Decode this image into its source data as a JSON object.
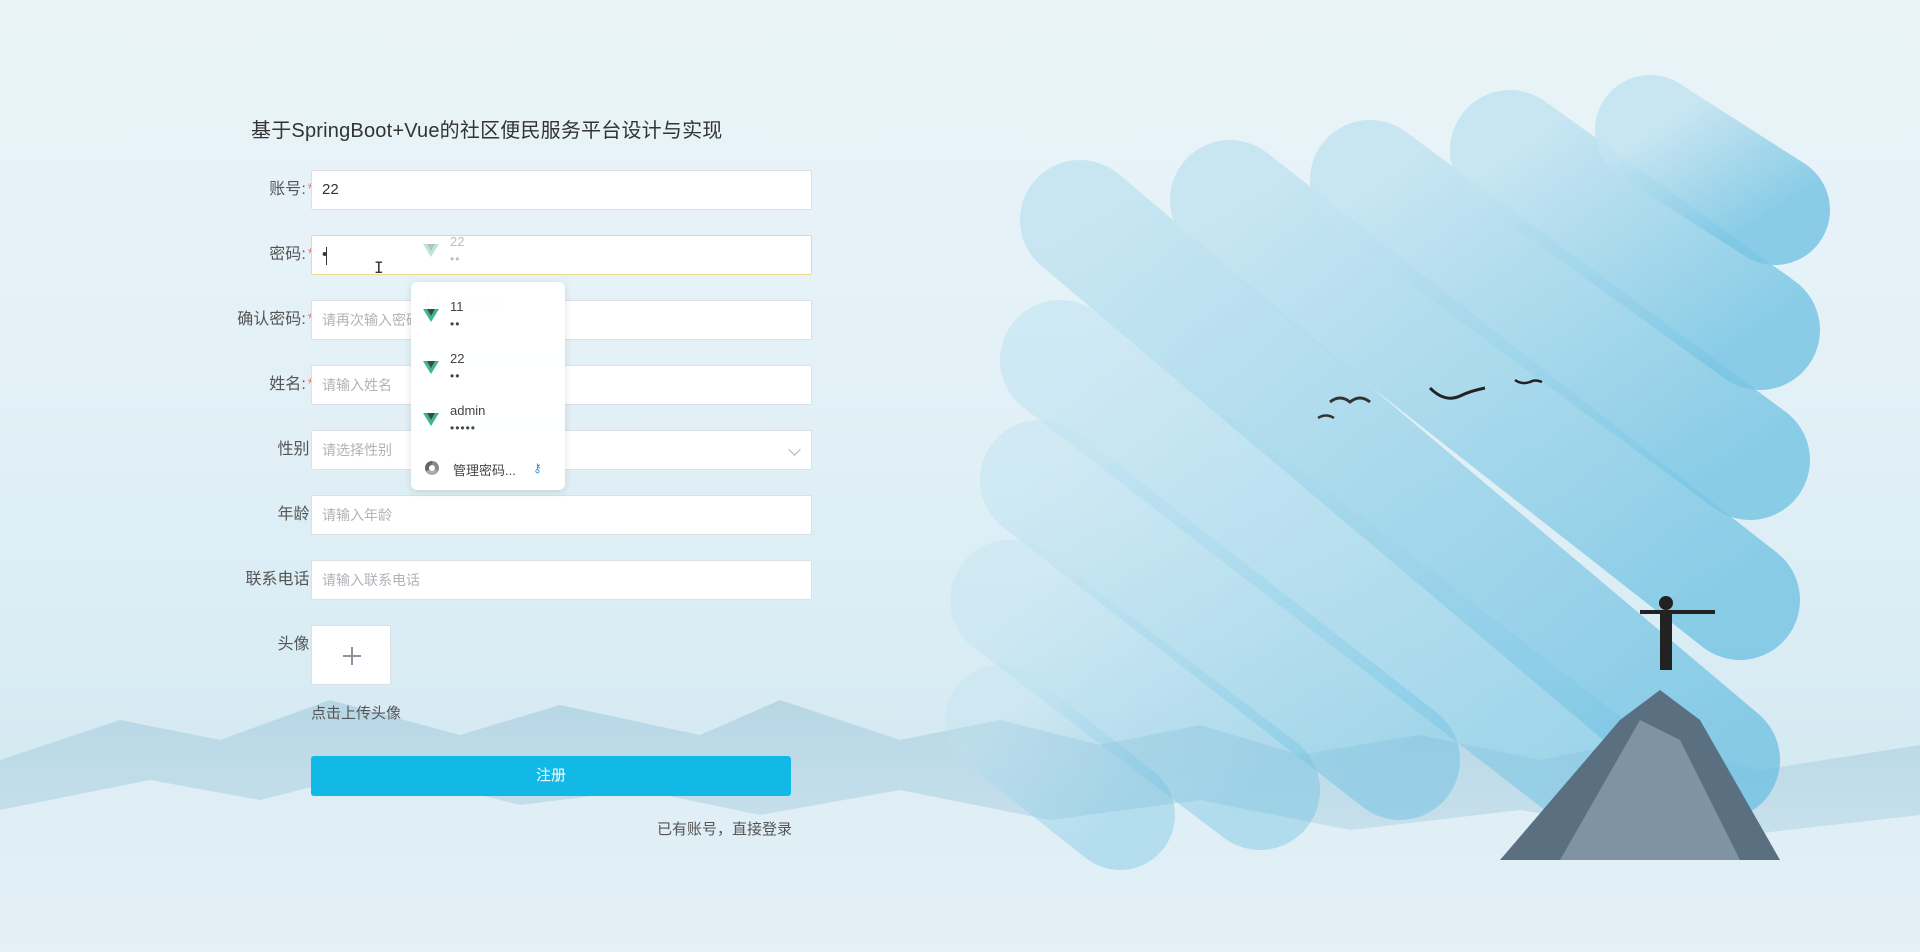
{
  "title": "基于SpringBoot+Vue的社区便民服务平台设计与实现",
  "form": {
    "account": {
      "label": "账号",
      "required_mark": "*",
      "value": "22"
    },
    "password": {
      "label": "密码",
      "required_mark": "*",
      "value": "•"
    },
    "confirm_password": {
      "label": "确认密码",
      "required_mark": "*",
      "placeholder": "请再次输入密码"
    },
    "name": {
      "label": "姓名",
      "required_mark": "*",
      "placeholder": "请输入姓名"
    },
    "gender": {
      "label": "性别",
      "placeholder": "请选择性别"
    },
    "age": {
      "label": "年龄",
      "placeholder": "请输入年龄"
    },
    "phone": {
      "label": "联系电话",
      "placeholder": "请输入联系电话"
    },
    "avatar": {
      "label": "头像",
      "hint": "点击上传头像"
    },
    "submit_label": "注册",
    "login_link": "已有账号，直接登录"
  },
  "autofill": {
    "ghost": {
      "username": "22",
      "password": "••",
      "manage": "管理密码..."
    },
    "items": [
      {
        "username": "11",
        "password": "••"
      },
      {
        "username": "22",
        "password": "••"
      },
      {
        "username": "admin",
        "password": "•••••"
      }
    ],
    "manage_label": "管理密码...",
    "icon_brand": "vue-logo-icon"
  },
  "colors": {
    "primary": "#13b9e6",
    "required": "#f56c6c",
    "focus_border": "#f0d98f"
  }
}
